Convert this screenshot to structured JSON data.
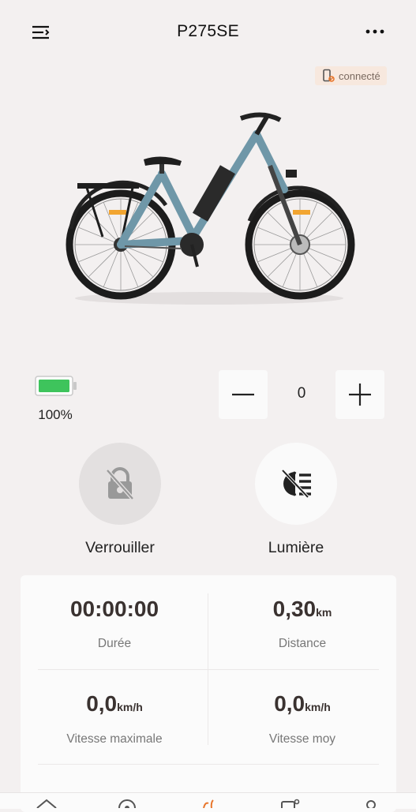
{
  "header": {
    "title": "P275SE",
    "menu_icon": "menu-icon",
    "more_icon": "more-dots-icon"
  },
  "connection": {
    "status_label": "connecté",
    "icon": "phone-link-icon",
    "color": "#f7e8de"
  },
  "battery": {
    "level": 1.0,
    "percent_label": "100%",
    "fill_color": "#3ec45c"
  },
  "assist": {
    "value": "0",
    "minus_icon": "minus-icon",
    "plus_icon": "plus-icon"
  },
  "controls": {
    "lock_label": "Verrouiller",
    "lock_icon": "lock-off-icon",
    "light_label": "Lumière",
    "light_icon": "headlight-icon"
  },
  "stats": {
    "duration": {
      "value": "00:00:00",
      "unit": "",
      "label": "Durée"
    },
    "distance": {
      "value": "0,30",
      "unit": "km",
      "label": "Distance"
    },
    "max_speed": {
      "value": "0,0",
      "unit": "km/h",
      "label": "Vitesse maximale"
    },
    "avg_speed": {
      "value": "0,0",
      "unit": "km/h",
      "label": "Vitesse moy"
    }
  },
  "bottom_nav": {
    "items": [
      "home-icon",
      "location-icon",
      "ride-icon",
      "device-icon",
      "profile-icon"
    ],
    "active_color": "#e8762c"
  }
}
